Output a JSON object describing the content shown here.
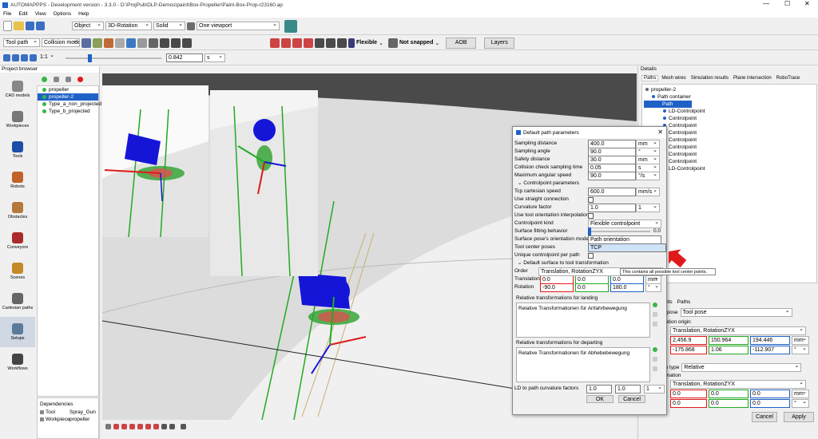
{
  "window": {
    "title": "AUTOMAPPPS - Development version - 3.3.0 - D:\\ProjPub\\DLP-Demos\\paint\\Box-Propeller\\Paint-Box-Prop-r23160.ap"
  },
  "menu": [
    "File",
    "Edit",
    "View",
    "Options",
    "Help"
  ],
  "toolbar1": {
    "object": "Object",
    "rotation": "3D-Rotation",
    "solid": "Solid",
    "viewport": "One viewport"
  },
  "toolbar2": {
    "toolpath": "Tool path",
    "collision": "Collision model",
    "flexible": "Flexible",
    "not_snapped": "Not snapped",
    "aob": "AOB",
    "layers": "Layers"
  },
  "toolbar3": {
    "ratio": "1:1",
    "value": "0.842",
    "unit": "s"
  },
  "project_browser": {
    "title": "Project browser",
    "categories": [
      "CAD models",
      "Workpieces",
      "Tools",
      "Robots",
      "Obstacles",
      "Conveyors",
      "Scenes",
      "Cartesian paths",
      "Setups",
      "Workflows"
    ],
    "items": [
      "propeller",
      "propeller-2",
      "Type_a_non_projected",
      "Type_b_projected"
    ],
    "selected_index": 1
  },
  "dependencies": {
    "title": "Dependencies",
    "rows": [
      [
        "Tool",
        "Spray_Gun"
      ],
      [
        "Workpiece",
        "propeller"
      ]
    ]
  },
  "details": {
    "title": "Details",
    "tabs": [
      "Paths",
      "Mesh wires",
      "Simulation results",
      "Plane intersection",
      "RoboTrace"
    ],
    "tree": [
      "propeller-2",
      "Path container",
      "Path",
      "LD-Controlpoint",
      "Controlpoint",
      "Controlpoint",
      "Controlpoint",
      "Controlpoint",
      "Controlpoint",
      "Controlpoint",
      "Controlpoint",
      "LD-Controlpoint"
    ],
    "lower_tabs": [
      "nts",
      "Paths"
    ],
    "pose_label": "d pose",
    "pose_value": "Tool pose",
    "origin_label": "ation origin",
    "order_value": "Translation, RotationZYX",
    "t1": [
      "2,456.9",
      "150.964",
      "194.446",
      "mm"
    ],
    "r1": [
      "-175.868",
      "1.06",
      "-112.907",
      "°"
    ],
    "type_label": "on type",
    "type_value": "Relative",
    "mation_label": "mation",
    "order2": "Translation, RotationZYX",
    "t2": [
      "0.0",
      "0.0",
      "0.0",
      "mm"
    ],
    "r2": [
      "0.0",
      "0.0",
      "0.0",
      "°"
    ],
    "cancel": "Cancel",
    "apply": "Apply"
  },
  "dialog": {
    "title": "Default path parameters",
    "params": [
      [
        "Sampling distance",
        "400.0",
        "mm"
      ],
      [
        "Sampling angle",
        "90.0",
        "°"
      ],
      [
        "Safety distance",
        "30.0",
        "mm"
      ],
      [
        "Collision check sampling time",
        "0.05",
        "s"
      ],
      [
        "Maximum angular speed",
        "90.0",
        "°/s"
      ]
    ],
    "cp_header": "Controlpoint parameters",
    "tcp_speed": [
      "Tcp cartesian speed",
      "600.0",
      "mm/s"
    ],
    "straight": "Use straight connection",
    "curv": [
      "Curvature factor",
      "1.0",
      "1"
    ],
    "interp": "Use tool orientation interpolation",
    "cpkind": [
      "Controlpoint kind",
      "Flexible controlpoint"
    ],
    "surf_fit": [
      "Surface fitting behavior",
      "0.0"
    ],
    "orient_mode": [
      "Surface pose's orientation mode",
      "Path orientation"
    ],
    "tcp": [
      "Tool center poses",
      "TCP"
    ],
    "tooltip": "This contains all possible tool center points.",
    "unique": "Unique controlpoint per path",
    "def_surface": "Default surface to tool transformation",
    "order": [
      "Order",
      "Translation, RotationZYX"
    ],
    "translation": [
      "Translation",
      "0.0",
      "0.0",
      "0.0",
      "mm"
    ],
    "rotation": [
      "Rotation",
      "-90.0",
      "0.0",
      "180.0",
      "°"
    ],
    "landing": [
      "Relative transformations for landing",
      "Relative Transformationen für Anfahrbewegung"
    ],
    "departing": [
      "Relative transformations for departing",
      "Relative Transformationen für Abhebebewegung"
    ],
    "ld": [
      "LD to path curvature factors",
      "1.0",
      "1.0",
      "1"
    ],
    "ok": "OK",
    "cancel": "Cancel"
  },
  "colors": {
    "accent": "#1f62c7",
    "red_arrow": "#e01a1a",
    "viewport": "#4a4a4a"
  }
}
